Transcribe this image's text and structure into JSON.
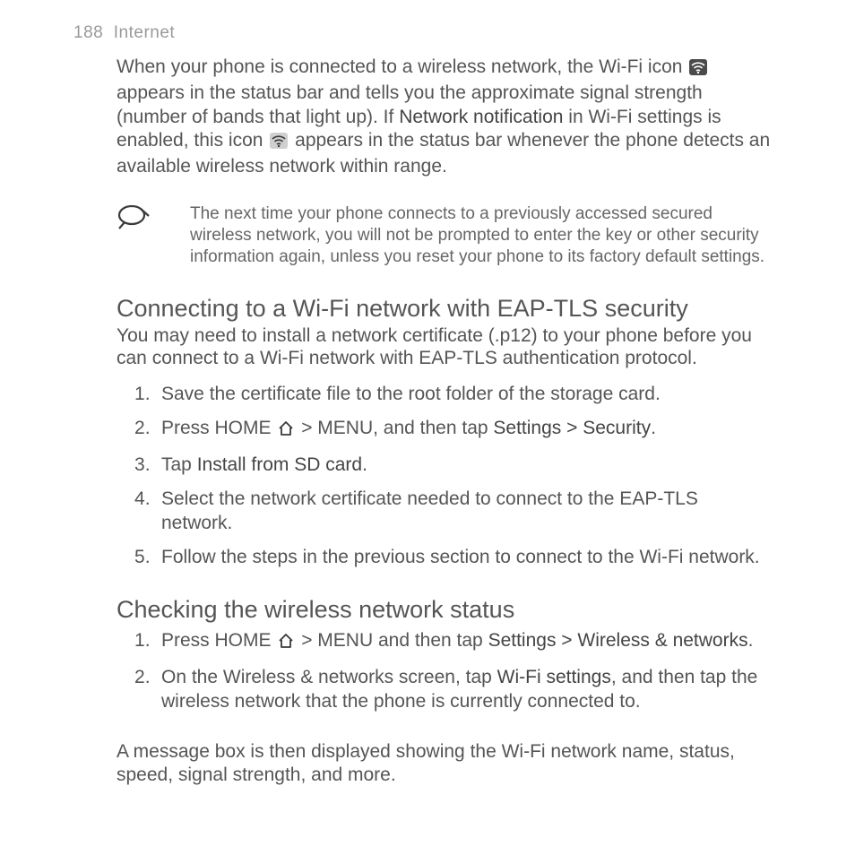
{
  "header": {
    "pageNumber": "188",
    "chapter": "Internet"
  },
  "intro": {
    "t1": "When your phone is connected to a wireless network, the Wi-Fi icon ",
    "t2": " appears in the status bar and tells you the approximate signal strength (number of bands that light up). If ",
    "t3": "Network notification",
    "t4": " in Wi-Fi settings is enabled, this icon ",
    "t5": " appears in the status bar whenever the phone detects an available wireless network within range."
  },
  "note": {
    "text": "The next time your phone connects to a previously accessed secured wireless network, you will not be prompted to enter the key or other security information again, unless you reset your phone to its factory default settings."
  },
  "section1": {
    "title": "Connecting to a Wi-Fi network with EAP-TLS security",
    "sub": "You may need to install a network certificate (.p12) to your phone before you can connect to a Wi-Fi network with EAP-TLS authentication protocol.",
    "steps": {
      "s1": "Save the certificate file to the root folder of the storage card.",
      "s2a": "Press HOME ",
      "s2b": " > MENU, and then tap ",
      "s2c": "Settings > Security",
      "s2d": ".",
      "s3a": "Tap ",
      "s3b": "Install from SD card",
      "s3c": ".",
      "s4": "Select the network certificate needed to connect to the EAP-TLS network.",
      "s5": "Follow the steps in the previous section to connect to the Wi-Fi network."
    }
  },
  "section2": {
    "title": "Checking the wireless network status",
    "steps": {
      "s1a": "Press HOME ",
      "s1b": " > MENU and then tap ",
      "s1c": "Settings > Wireless & networks",
      "s1d": ".",
      "s2a": "On the Wireless & networks screen, tap ",
      "s2b": "Wi-Fi settings",
      "s2c": ", and then tap the wireless network that the phone is currently connected to."
    },
    "outro": "A message box is then displayed showing the Wi-Fi network name, status, speed, signal strength, and more."
  }
}
